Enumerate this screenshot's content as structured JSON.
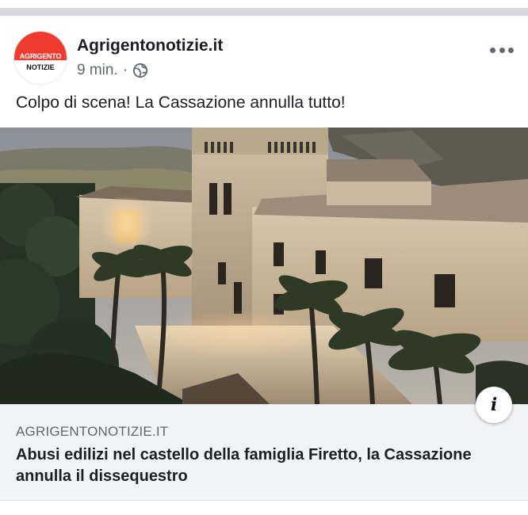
{
  "post": {
    "page_name": "Agrigentonotizie.it",
    "avatar": {
      "line1": "AGRIGENTO",
      "line2": "NOTIZIE",
      "accent": "#ef3b2d"
    },
    "time": "9 min.",
    "separator": "·",
    "privacy_icon": "globe-icon",
    "more_icon": "more-options-icon",
    "text": "Colpo di scena! La Cassazione annulla tutto!"
  },
  "link_preview": {
    "domain": "AGRIGENTONOTIZIE.IT",
    "title": "Abusi edilizi nel castello della famiglia Firetto, la Cassazione annulla il dissequestro",
    "info_label": "i"
  }
}
